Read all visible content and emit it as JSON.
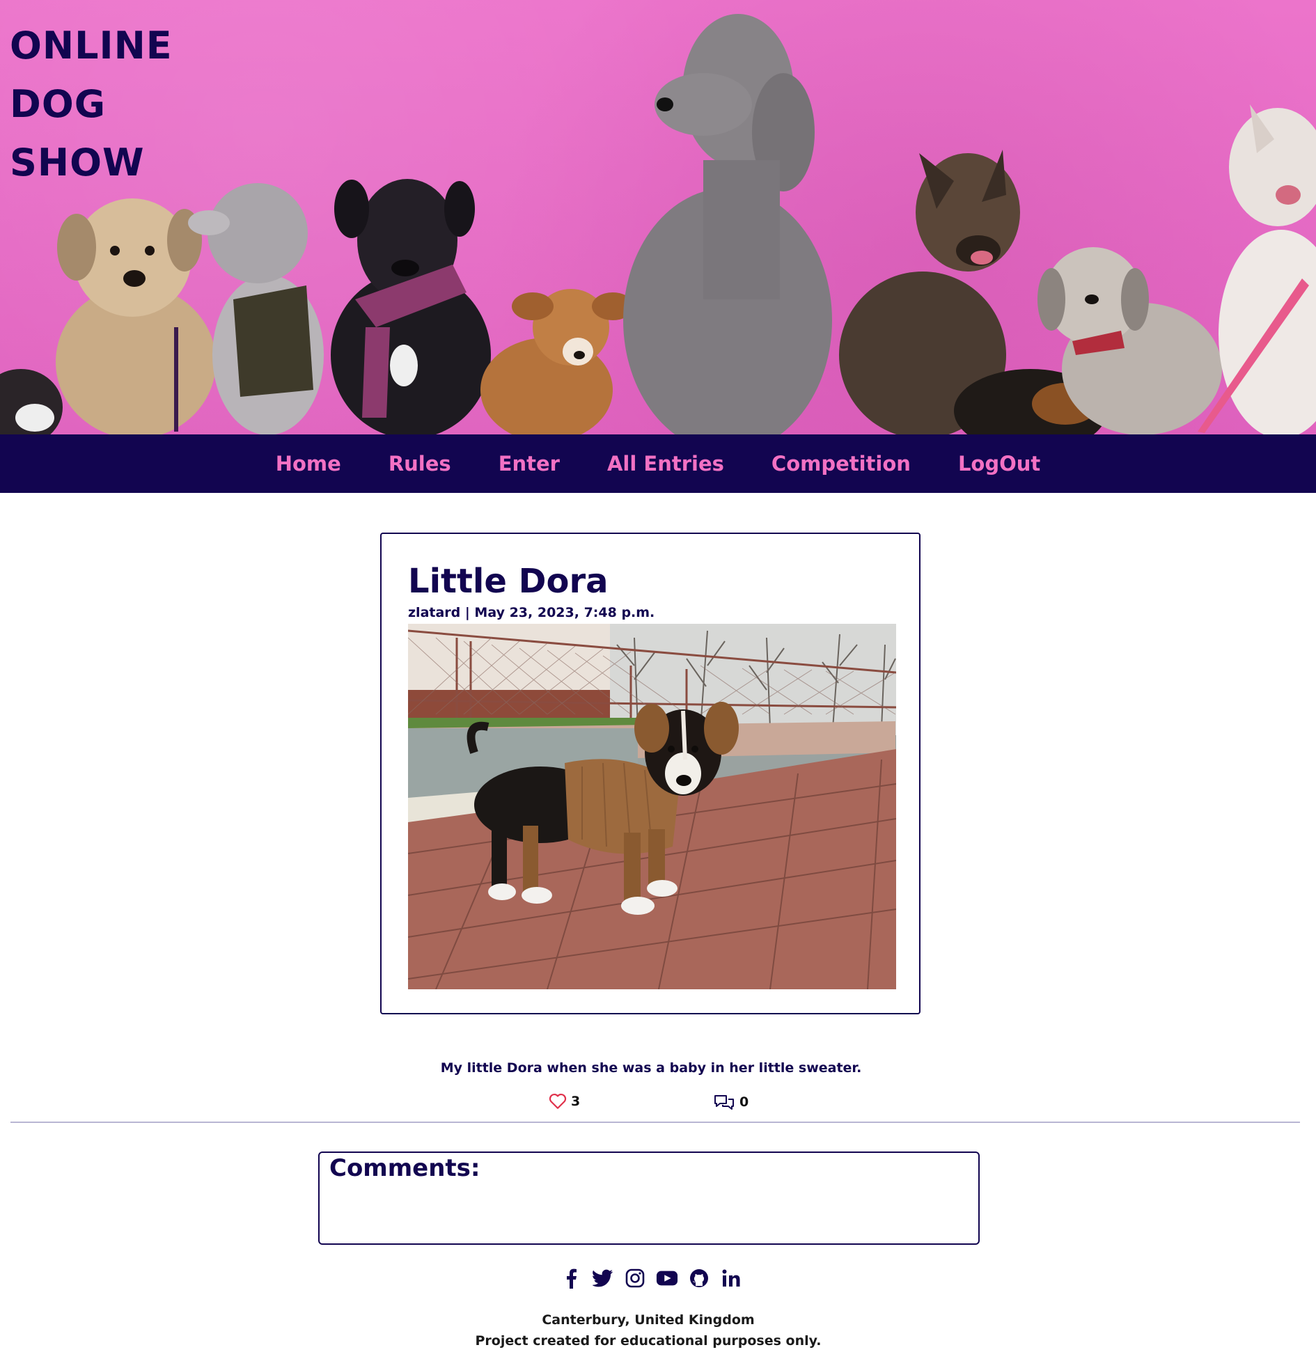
{
  "site": {
    "title_lines": [
      "ONLINE",
      "DOG",
      "SHOW"
    ]
  },
  "nav": {
    "items": [
      {
        "label": "Home"
      },
      {
        "label": "Rules"
      },
      {
        "label": "Enter"
      },
      {
        "label": "All Entries"
      },
      {
        "label": "Competition"
      },
      {
        "label": "LogOut"
      }
    ]
  },
  "post": {
    "title": "Little Dora",
    "meta": "zlatard | May 23, 2023, 7:48 p.m.",
    "image_alt": "Puppy in a brown sweater",
    "description": "My little Dora when she was a baby in her little sweater.",
    "likes": "3",
    "comments_count": "0"
  },
  "comments": {
    "heading": "Comments:"
  },
  "footer": {
    "social": [
      "facebook-icon",
      "twitter-icon",
      "instagram-icon",
      "youtube-icon",
      "github-icon",
      "linkedin-icon"
    ],
    "location": "Canterbury, United Kingdom",
    "note": "Project created for educational purposes only."
  },
  "colors": {
    "navy": "#120550",
    "pink": "#f371c4",
    "hero_bg": "#ea6fc8",
    "like_heart": "#e0314b"
  }
}
